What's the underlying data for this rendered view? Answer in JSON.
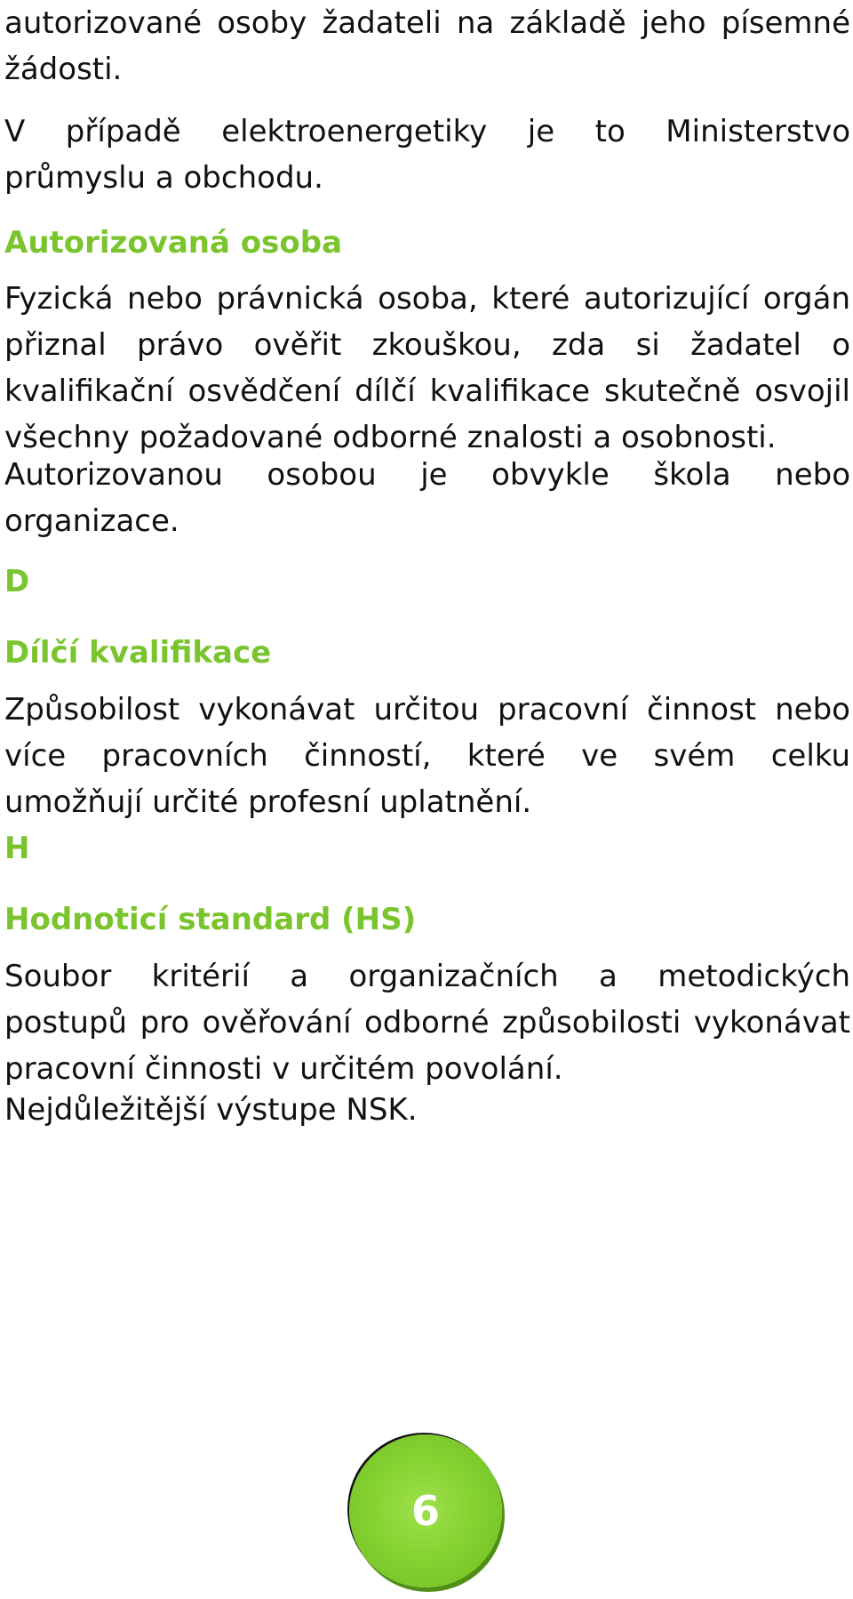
{
  "paragraphs": {
    "p1": {
      "l1": "autorizované osoby žadateli na základě jeho písemné",
      "l2": "žádosti."
    },
    "p2": {
      "l1": "V případě elektroenergetiky je to Ministerstvo",
      "l2": "průmyslu a obchodu."
    },
    "h_autorizovana": "Autorizovaná osoba",
    "p3": [
      "Fyzická nebo právnická osoba, které autorizující orgán",
      "přiznal právo ověřit zkouškou, zda si žadatel o",
      "kvalifikační osvědčení dílčí kvalifikace skutečně osvojil",
      "všechny požadované odborné znalosti a osobnosti."
    ],
    "p4": {
      "l1": "Autorizovanou osobou je obvykle škola nebo",
      "l2": "organizace."
    },
    "letter_d": "D",
    "h_dilci": "Dílčí kvalifikace",
    "p5": [
      "Způsobilost vykonávat určitou pracovní činnost nebo",
      "více pracovních činností, které ve svém celku",
      "umožňují určité profesní uplatnění."
    ],
    "letter_h": "H",
    "h_hodnotici": "Hodnoticí standard (HS)",
    "p6": [
      "Soubor kritérií a organizačních a metodických",
      "postupů pro ověřování odborné způsobilosti vykonávat",
      "pracovní činnosti v určitém povolání."
    ],
    "p7": "Nejdůležitější výstupe NSK."
  },
  "page_number": "6",
  "colors": {
    "accent": "#7ac52e",
    "text": "#111111"
  }
}
